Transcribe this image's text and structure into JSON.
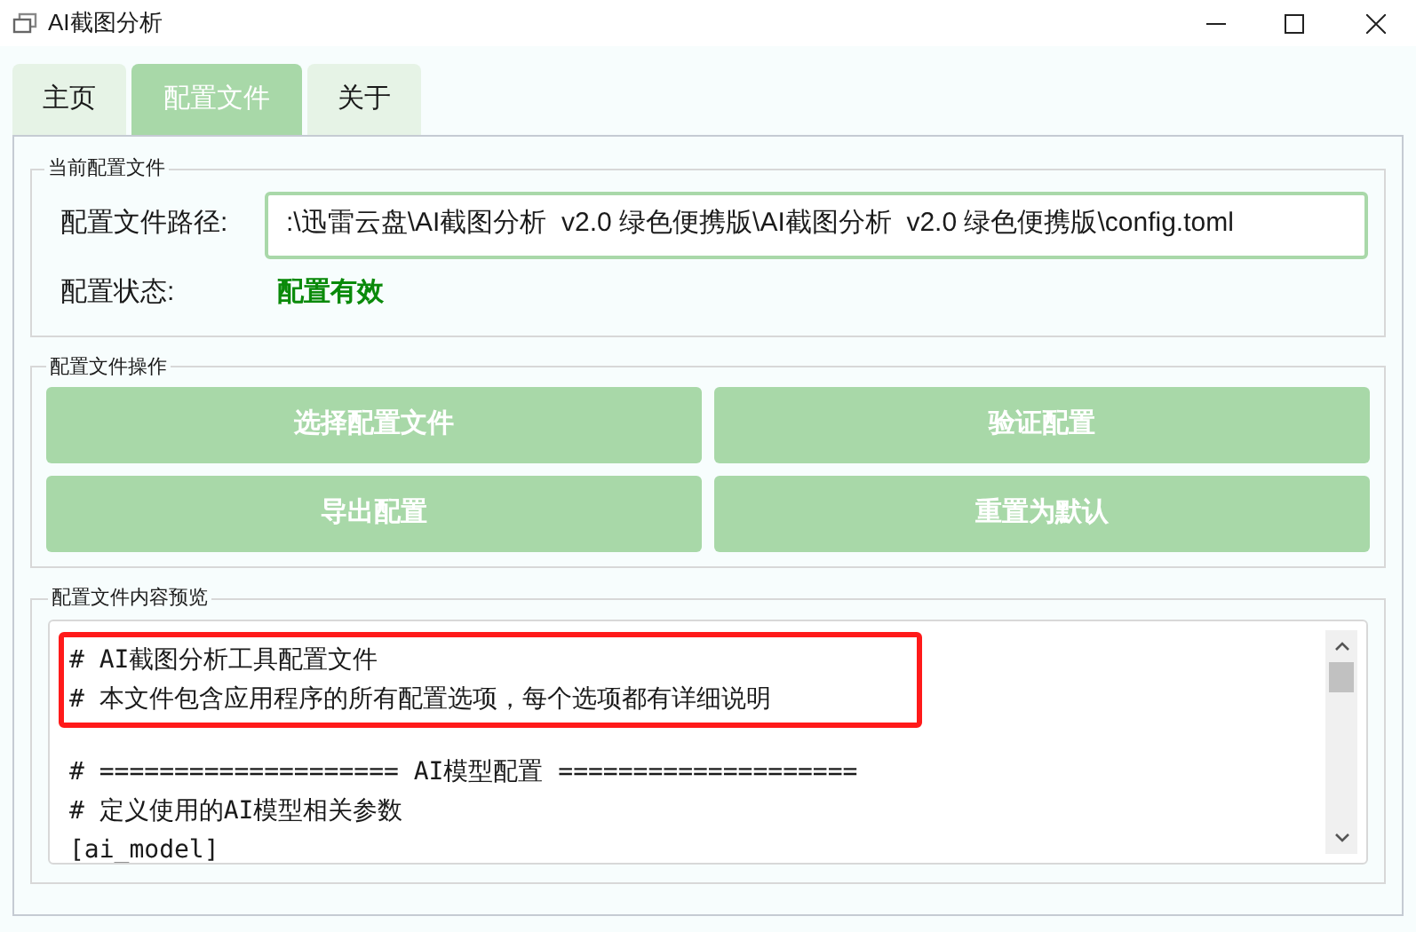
{
  "window": {
    "title": "AI截图分析"
  },
  "tabs": [
    {
      "label": "主页",
      "selected": false
    },
    {
      "label": "配置文件",
      "selected": true
    },
    {
      "label": "关于",
      "selected": false
    }
  ],
  "current_config": {
    "title": "当前配置文件",
    "path_label": "配置文件路径:",
    "path_value": ":\\迅雷云盘\\AI截图分析  v2.0 绿色便携版\\AI截图分析  v2.0 绿色便携版\\config.toml",
    "status_label": "配置状态:",
    "status_value": "配置有效"
  },
  "operations": {
    "title": "配置文件操作",
    "buttons": [
      "选择配置文件",
      "验证配置",
      "导出配置",
      "重置为默认"
    ]
  },
  "preview": {
    "title": "配置文件内容预览",
    "highlighted_lines": [
      "# AI截图分析工具配置文件",
      "# 本文件包含应用程序的所有配置选项，每个选项都有详细说明"
    ],
    "lines": [
      "# ==================== AI模型配置 ====================",
      "# 定义使用的AI模型相关参数",
      "[ai_model]"
    ]
  }
}
